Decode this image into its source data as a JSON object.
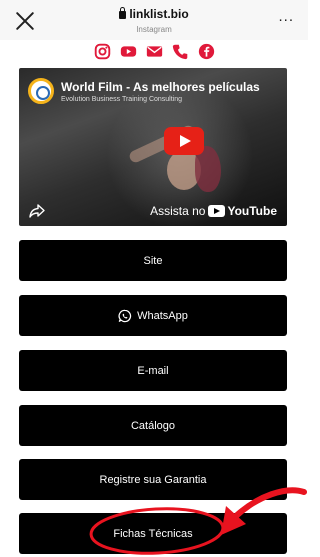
{
  "browser": {
    "url": "linklist.bio",
    "subtitle": "Instagram",
    "more_label": "..."
  },
  "social_icons": [
    "instagram-icon",
    "youtube-icon",
    "email-icon",
    "phone-icon",
    "facebook-icon"
  ],
  "video": {
    "title": "World Film - As melhores películas",
    "channel": "Evolution Business Training Consulting",
    "watch_on": "Assista no",
    "platform": "YouTube"
  },
  "links": [
    {
      "label": "Site"
    },
    {
      "label": "WhatsApp",
      "icon": "whatsapp-icon"
    },
    {
      "label": "E-mail"
    },
    {
      "label": "Catálogo"
    },
    {
      "label": "Registre sua Garantia"
    },
    {
      "label": "Fichas Técnicas"
    }
  ],
  "colors": {
    "button_bg": "#000000",
    "icon_red": "#e0193a",
    "annotation_red": "#e8131f"
  }
}
